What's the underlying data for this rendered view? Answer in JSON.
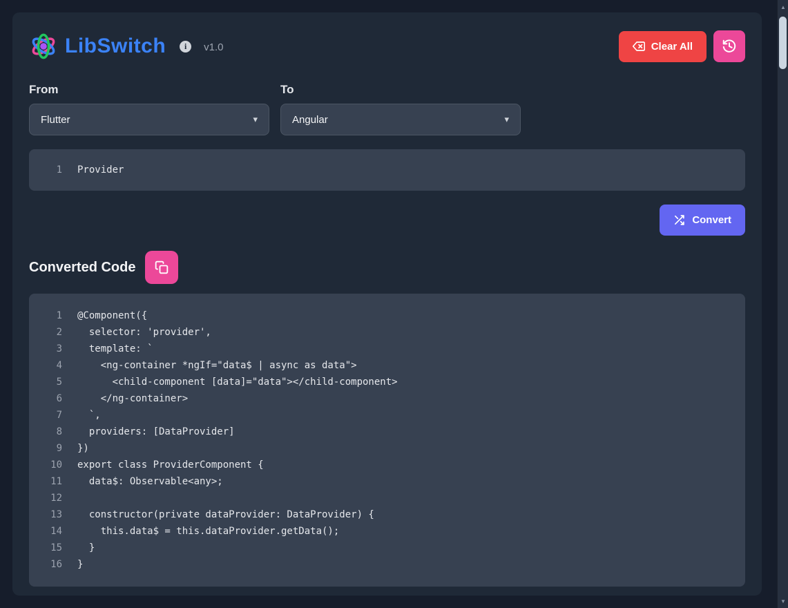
{
  "app": {
    "title": "LibSwitch",
    "version": "v1.0"
  },
  "header": {
    "clear_all_label": "Clear All"
  },
  "converter": {
    "from_label": "From",
    "from_value": "Flutter",
    "to_label": "To",
    "to_value": "Angular",
    "convert_label": "Convert",
    "input_lines": [
      {
        "num": "1",
        "text": "Provider"
      }
    ]
  },
  "output": {
    "heading": "Converted Code",
    "lines": [
      {
        "num": "1",
        "text": "@Component({"
      },
      {
        "num": "2",
        "text": "  selector: 'provider',"
      },
      {
        "num": "3",
        "text": "  template: `"
      },
      {
        "num": "4",
        "text": "    <ng-container *ngIf=\"data$ | async as data\">"
      },
      {
        "num": "5",
        "text": "      <child-component [data]=\"data\"></child-component>"
      },
      {
        "num": "6",
        "text": "    </ng-container>"
      },
      {
        "num": "7",
        "text": "  `,"
      },
      {
        "num": "8",
        "text": "  providers: [DataProvider]"
      },
      {
        "num": "9",
        "text": "})"
      },
      {
        "num": "10",
        "text": "export class ProviderComponent {"
      },
      {
        "num": "11",
        "text": "  data$: Observable<any>;"
      },
      {
        "num": "12",
        "text": ""
      },
      {
        "num": "13",
        "text": "  constructor(private dataProvider: DataProvider) {"
      },
      {
        "num": "14",
        "text": "    this.data$ = this.dataProvider.getData();"
      },
      {
        "num": "15",
        "text": "  }"
      },
      {
        "num": "16",
        "text": "}"
      }
    ]
  },
  "colors": {
    "accent_blue": "#3b82f6",
    "danger_red": "#ef4444",
    "pink": "#ec4899",
    "indigo": "#6366f1",
    "panel": "#374151",
    "container": "#1f2937"
  }
}
